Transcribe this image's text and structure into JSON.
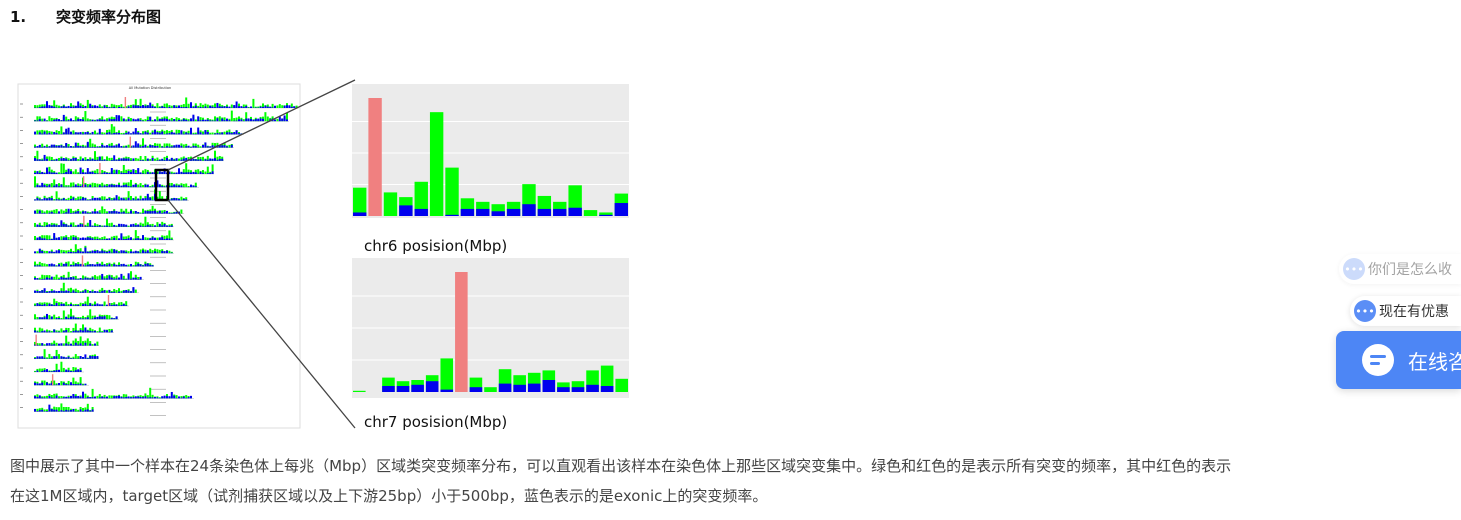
{
  "heading": {
    "number": "1.",
    "title": "突变频率分布图"
  },
  "figure": {
    "overview_title": "All Mutation Distribution",
    "chr6": {
      "xlabel": "chr6 posision(Mbp)",
      "green_values": [
        0.24,
        0.18,
        0.2,
        0.16,
        0.29,
        0.88,
        0.41,
        0.15,
        0.12,
        0.1,
        0.12,
        0.27,
        0.17,
        0.12,
        0.26,
        0.05,
        0.03,
        0.19
      ],
      "blue_values": [
        0.03,
        0.06,
        0.0,
        0.09,
        0.06,
        0.0,
        0.01,
        0.06,
        0.06,
        0.04,
        0.06,
        0.1,
        0.06,
        0.06,
        0.07,
        0.0,
        0.01,
        0.11
      ],
      "red_value": 1.0
    },
    "chr7": {
      "xlabel": "chr7 posision(Mbp)",
      "green_values": [
        0.01,
        0.0,
        0.12,
        0.09,
        0.1,
        0.14,
        0.28,
        0.0,
        0.12,
        0.04,
        0.19,
        0.14,
        0.16,
        0.18,
        0.08,
        0.09,
        0.18,
        0.22,
        0.11
      ],
      "blue_values": [
        0.0,
        0.0,
        0.05,
        0.05,
        0.06,
        0.09,
        0.02,
        0.0,
        0.04,
        0.0,
        0.07,
        0.06,
        0.07,
        0.1,
        0.04,
        0.04,
        0.06,
        0.05,
        0.0
      ],
      "red_value": 1.0
    }
  },
  "caption": {
    "line1": "图中展示了其中一个样本在24条染色体上每兆（Mbp）区域类突变频率分布，可以直观看出该样本在染色体上那些区域突变集中。绿色和红色的是表示所有突变的频率，其中红色的表示",
    "line2": "在这1M区域内，target区域（试剂捕获区域以及上下游25bp）小于500bp，蓝色表示的是exonic上的突变频率。"
  },
  "floating": {
    "pill1_text": "你们是怎么收",
    "pill1_icon": "chat-bubble-icon",
    "pill2_text": "现在有优惠",
    "pill2_icon": "chat-bubble-icon",
    "consult_text": "在线咨",
    "consult_icon": "chat-bubble-icon"
  },
  "colors": {
    "green": "#00ff00",
    "blue": "#0000ee",
    "red": "#f08080",
    "panel_bg": "#ebebeb",
    "accent": "#4d86f5"
  }
}
